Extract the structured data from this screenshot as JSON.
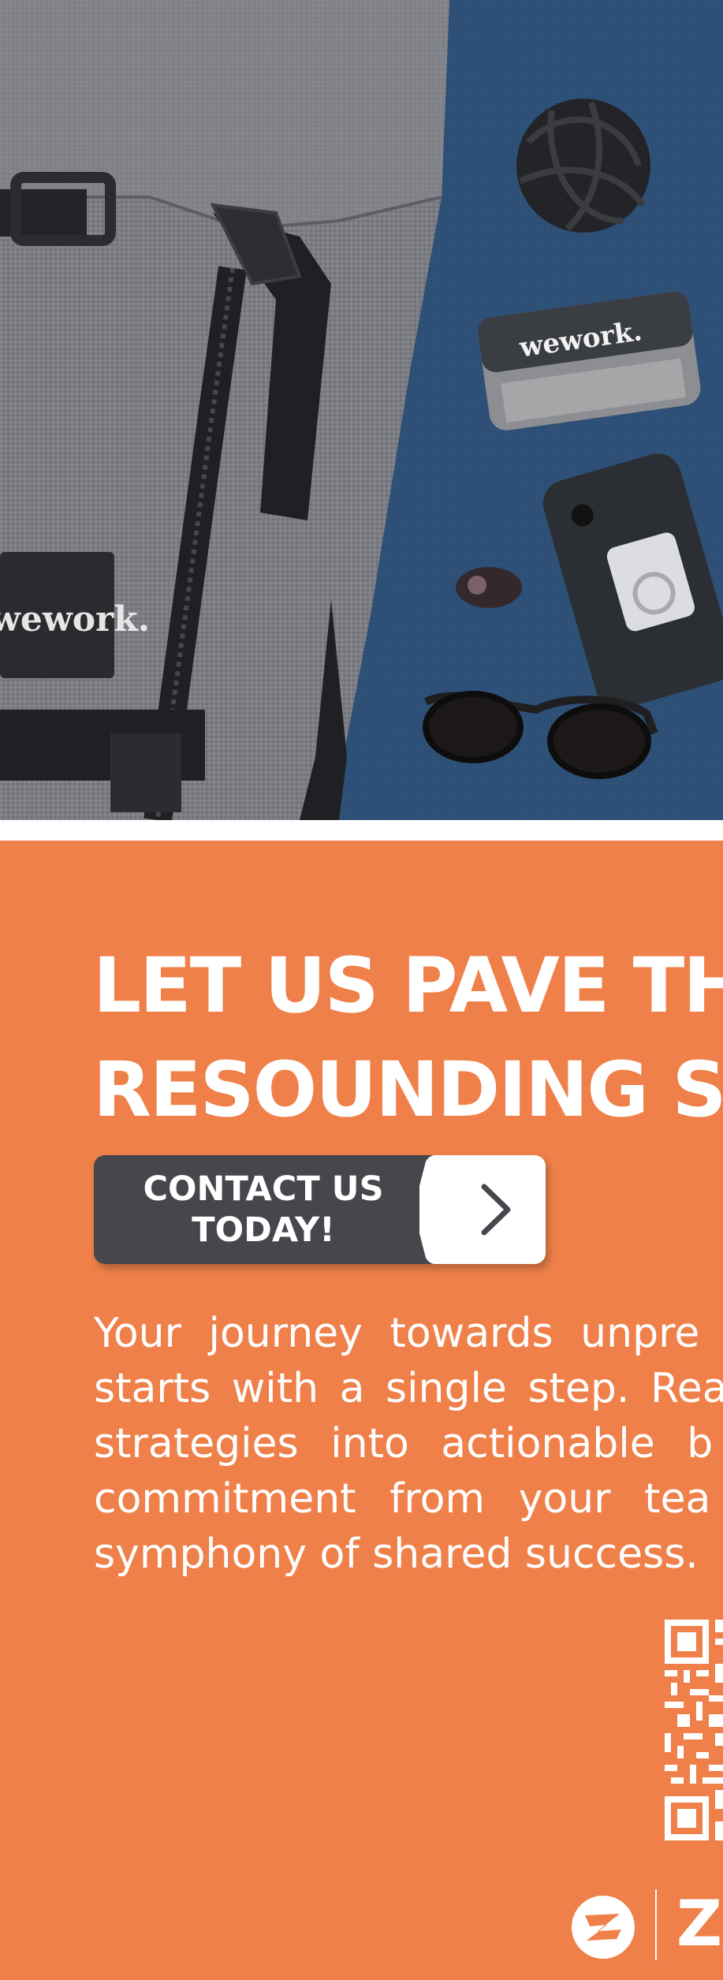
{
  "photo": {
    "brand_print": "wework.",
    "colors": {
      "carpet": "#2c4d74",
      "backpack": "#7d7f84",
      "strap": "#222326"
    }
  },
  "promo": {
    "headline_line1": "LET US PAVE TH",
    "headline_line2": "RESOUNDING S",
    "cta_label_line1": "CONTACT US",
    "cta_label_line2": "TODAY!",
    "cta_icon": "chevron-right-icon",
    "body_lines": [
      "Your journey towards unpre",
      "starts with a single step. Rea",
      "strategies into actionable b",
      "commitment from your tea",
      "symphony of shared success."
    ],
    "logo_text": "ZA",
    "colors": {
      "background": "#ef8049",
      "cta": "#46474c",
      "text": "#ffffff"
    }
  }
}
